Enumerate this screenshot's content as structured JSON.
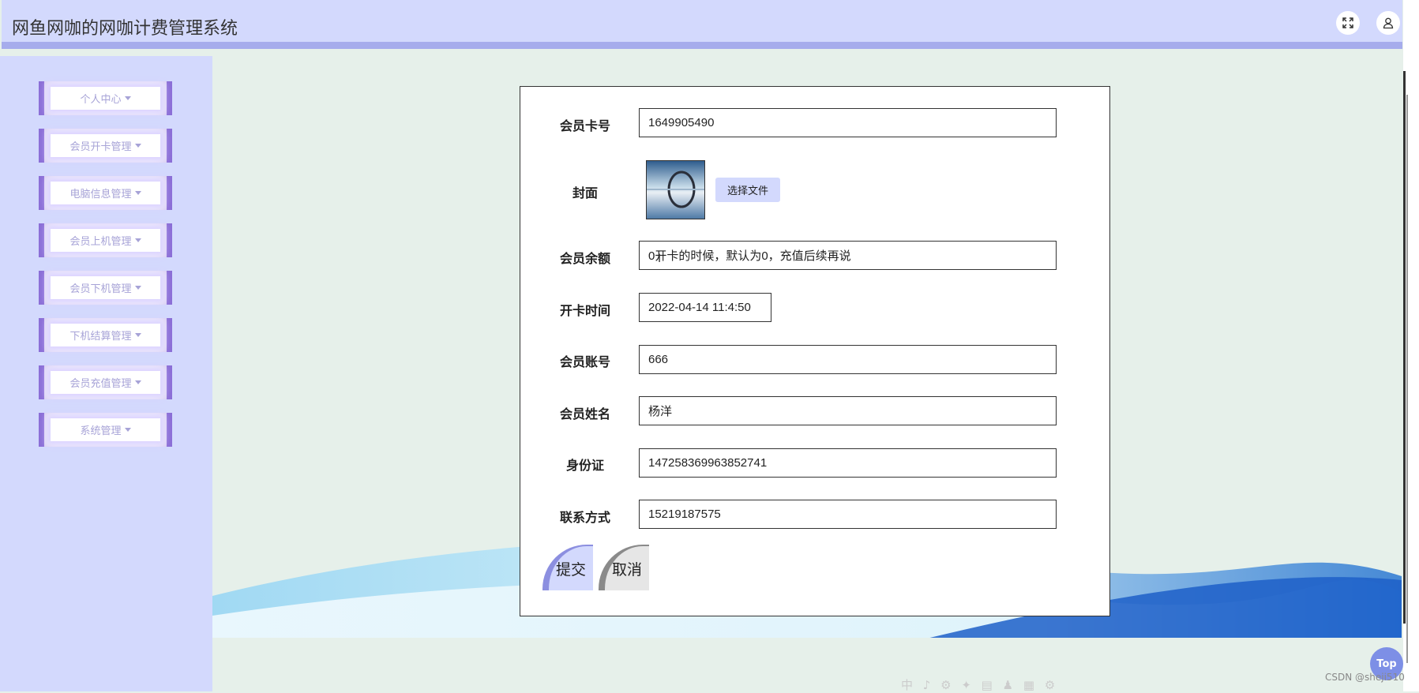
{
  "header": {
    "title": "网鱼网咖的网咖计费管理系统",
    "fullscreen_icon": "expand-icon",
    "user_icon": "user-icon"
  },
  "sidebar": {
    "items": [
      {
        "label": "个人中心"
      },
      {
        "label": "会员开卡管理"
      },
      {
        "label": "电脑信息管理"
      },
      {
        "label": "会员上机管理"
      },
      {
        "label": "会员下机管理"
      },
      {
        "label": "下机结算管理"
      },
      {
        "label": "会员充值管理"
      },
      {
        "label": "系统管理"
      }
    ]
  },
  "form": {
    "card_no": {
      "label": "会员卡号",
      "value": "1649905490"
    },
    "cover": {
      "label": "封面",
      "button": "选择文件"
    },
    "balance": {
      "label": "会员余额",
      "value": "0开卡的时候，默认为0，充值后续再说"
    },
    "open_time": {
      "label": "开卡时间",
      "value": "2022-04-14 11:4:50"
    },
    "account": {
      "label": "会员账号",
      "value": "666"
    },
    "name": {
      "label": "会员姓名",
      "value": "杨洋"
    },
    "id_card": {
      "label": "身份证",
      "value": "147258369963852741"
    },
    "phone": {
      "label": "联系方式",
      "value": "15219187575"
    },
    "submit": "提交",
    "cancel": "取消"
  },
  "misc": {
    "top_button": "Top",
    "watermark": "CSDN @sheji510",
    "ime_toolbar": "中 ♪ ⚙ ✦ ▤ ♟ ▦ ⚙"
  },
  "colors": {
    "header_bg": "#d3d9fd",
    "accent": "#8c6fd8",
    "page_bg": "#e6f0ea"
  }
}
